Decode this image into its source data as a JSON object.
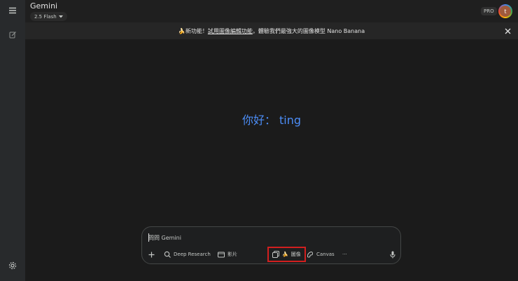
{
  "header": {
    "app_title": "Gemini",
    "model": "2.5 Flash",
    "pro_badge": "PRO",
    "avatar_initial": "t"
  },
  "banner": {
    "emoji": "🍌",
    "prefix": " 新功能！",
    "link_text": "試用圖像編輯功能",
    "suffix": "，體驗我們最強大的圖像模型 Nano Banana"
  },
  "greeting": "你好： ting",
  "composer": {
    "placeholder": "問問 Gemini",
    "tools": {
      "deep_research": "Deep Research",
      "video": "影片",
      "image_emoji": "🍌",
      "image": "圖像",
      "canvas": "Canvas",
      "more": "···"
    }
  },
  "icons": {
    "menu": "menu-icon",
    "edit": "edit-icon",
    "settings": "gear-icon",
    "close": "close-icon",
    "add": "plus-icon",
    "research": "deep-research-icon",
    "video": "video-icon",
    "image": "image-icon",
    "canvas": "canvas-icon",
    "mic": "mic-icon"
  },
  "colors": {
    "greeting": "#4c8df6",
    "highlight": "#d21f1f"
  }
}
